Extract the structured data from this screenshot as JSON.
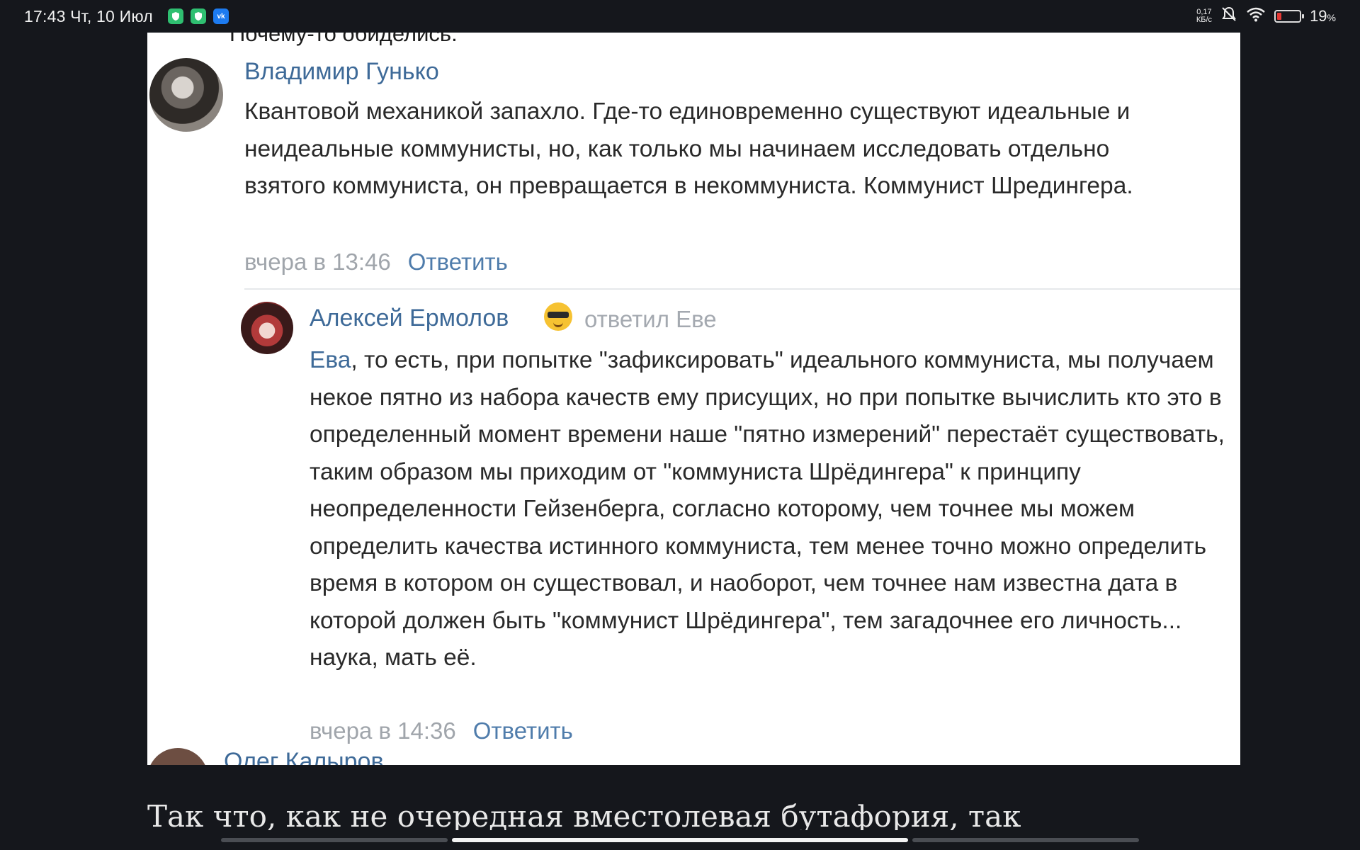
{
  "status_bar": {
    "time": "17:43 Чт, 10 Июл",
    "apps": [
      "shield-app-icon",
      "shield-app-icon",
      "vk-icon"
    ],
    "net_speed_value": "0,17",
    "net_speed_unit": "КБ/с",
    "battery_percent": "19",
    "battery_percent_sign": "%",
    "battery_level": 0.19
  },
  "post_image": {
    "clipped_top_text": "Почему-то обиделись.",
    "comments": [
      {
        "author": "Владимир Гунько",
        "text": "Квантовой механикой запахло. Где-то единовременно существуют идеальные и неидеальные коммунисты, но, как только мы начинаем исследовать отдельно взятого коммуниста, он превращается в некоммуниста. Коммунист Шредингера.",
        "time": "вчера в 13:46",
        "reply_label": "Ответить"
      },
      {
        "author": "Алексей Ермолов",
        "author_emoji": "sunglasses-emoji",
        "replied_to": "ответил Еве",
        "mention": "Ева",
        "text": ", то есть, при попытке \"зафиксировать\" идеального коммуниста, мы получаем некое пятно из набора качеств ему присущих, но при попытке вычислить кто это в определенный момент времени наше \"пятно измерений\" перестаёт существовать, таким образом мы приходим от \"коммуниста Шрёдингера\" к принципу неопределенности Гейзенберга, согласно которому, чем точнее мы можем определить качества истинного коммуниста, тем менее точно можно определить время в котором он существовал, и наоборот, чем точнее нам известна дата в которой должен быть \"коммунист Шрёдингера\", тем загадочнее его личность... наука, мать её.",
        "time": "вчера в 14:36",
        "reply_label": "Ответить"
      },
      {
        "author": "Олег Калыров"
      }
    ]
  },
  "article": {
    "bottom_text": "Так что, как не очередная вместолевая бутафория, так"
  },
  "colors": {
    "background": "#15171c",
    "link": "#3e6a98",
    "meta": "#a0a5ab"
  }
}
